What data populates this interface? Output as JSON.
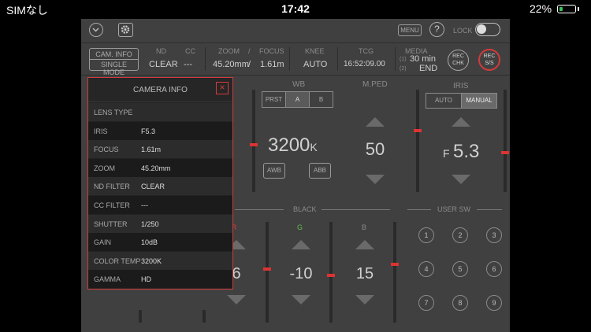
{
  "status_bar": {
    "carrier": "SIMなし",
    "time": "17:42",
    "battery_pct": "22%",
    "battery_level": 0.22,
    "battery_color": "#35c759"
  },
  "toolbar": {
    "menu_label": "MENU",
    "help_label": "?",
    "lock_label": "LOCK"
  },
  "info_strip": {
    "cam_info_label": "CAM. INFO",
    "single_mode_label": "SINGLE MODE",
    "nd_label": "ND",
    "nd_value": "CLEAR",
    "cc_label": "CC",
    "cc_value": "---",
    "zoom_label": "ZOOM",
    "zoom_value": "45.20mm",
    "focus_label": "FOCUS",
    "focus_value": "1.61m",
    "sep1": "/",
    "sep2": "/",
    "knee_label": "KNEE",
    "knee_value": "AUTO",
    "tcg_label": "TCG",
    "tcg_value": "16:52:09.00",
    "media_label": "MEDIA",
    "media_slot1": "(1)",
    "media_slot1_value": "30 min",
    "media_slot2": "(2)",
    "media_slot2_value": "END",
    "rec_chk_top": "REC",
    "rec_chk_bottom": "CHK",
    "rec_ss_top": "REC",
    "rec_ss_bottom": "S/S"
  },
  "wb": {
    "title": "WB",
    "presets": [
      "PRST",
      "A",
      "B"
    ],
    "value": "3200",
    "unit": "K",
    "awb_label": "AWB",
    "abb_label": "ABB",
    "slider_level": 0.46
  },
  "mped": {
    "title": "M.PED",
    "value": "50"
  },
  "iris": {
    "title": "IRIS",
    "auto_label": "AUTO",
    "manual_label": "MANUAL",
    "prefix": "F",
    "value": "5.3",
    "slider_level": 0.6,
    "right_slider_level": 0.38
  },
  "black": {
    "title": "BLACK",
    "r_label": "R",
    "g_label": "G",
    "b_label": "B",
    "r_value": "6",
    "g_value": "-10",
    "b_value": "15",
    "g_color": "#5fbf4a"
  },
  "user_sw": {
    "title": "USER SW",
    "buttons": [
      "1",
      "2",
      "3",
      "4",
      "5",
      "6",
      "7",
      "8",
      "9"
    ]
  },
  "camera_info": {
    "title": "CAMERA INFO",
    "close_label": "×",
    "rows": [
      {
        "key": "LENS TYPE",
        "value": ""
      },
      {
        "key": "IRIS",
        "value": "F5.3"
      },
      {
        "key": "FOCUS",
        "value": "1.61m"
      },
      {
        "key": "ZOOM",
        "value": "45.20mm"
      },
      {
        "key": "ND FILTER",
        "value": "CLEAR"
      },
      {
        "key": "CC FILTER",
        "value": "---"
      },
      {
        "key": "SHUTTER",
        "value": "1/250"
      },
      {
        "key": "GAIN",
        "value": "10dB"
      },
      {
        "key": "COLOR TEMP",
        "value": "3200K"
      },
      {
        "key": "GAMMA",
        "value": "HD"
      }
    ]
  },
  "colors": {
    "accent_red": "#d23b3b",
    "panel": "#404040"
  }
}
